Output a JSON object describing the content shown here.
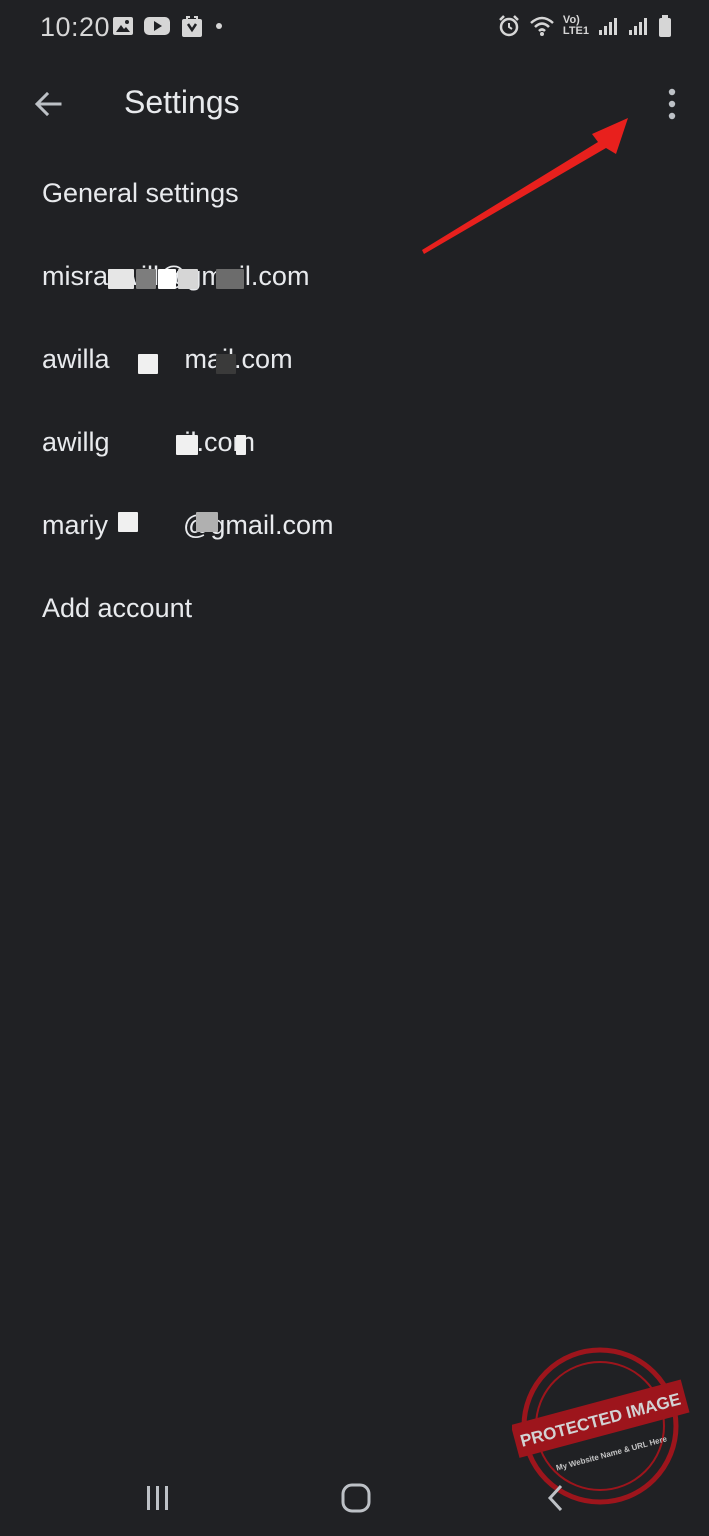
{
  "status_bar": {
    "time": "10:20",
    "left_icons": [
      "gallery-icon",
      "youtube-icon",
      "shopping-bag-icon",
      "notification-dot-icon"
    ],
    "right_icons": [
      "alarm-icon",
      "wifi-icon",
      "volte-icon",
      "signal-icon",
      "signal-icon",
      "battery-icon"
    ],
    "volte_top": "Vo)",
    "volte_bottom": "LTE1"
  },
  "app_bar": {
    "title": "Settings",
    "back_icon": "arrow-back-icon",
    "overflow_icon": "more-vert-icon"
  },
  "menu": {
    "items": [
      {
        "label": "General settings"
      },
      {
        "label": "misraswill@gmail.com"
      },
      {
        "label": "awilla          mail.com"
      },
      {
        "label": "awillg          il.com"
      },
      {
        "label": "mariy          @gmail.com"
      },
      {
        "label": "Add account"
      }
    ]
  },
  "annotation": {
    "arrow_color": "#e8201d"
  },
  "watermark": {
    "top_text": "PROTECTED IMAGE",
    "bottom_text": "My Website Name & URL Here",
    "color": "#b3131b"
  },
  "nav_bar": {
    "recents_icon": "recents-icon",
    "home_icon": "home-icon",
    "back_icon": "nav-back-icon"
  },
  "colors": {
    "background": "#202124",
    "text": "#e8eaed",
    "icon": "#bdc1c6"
  }
}
